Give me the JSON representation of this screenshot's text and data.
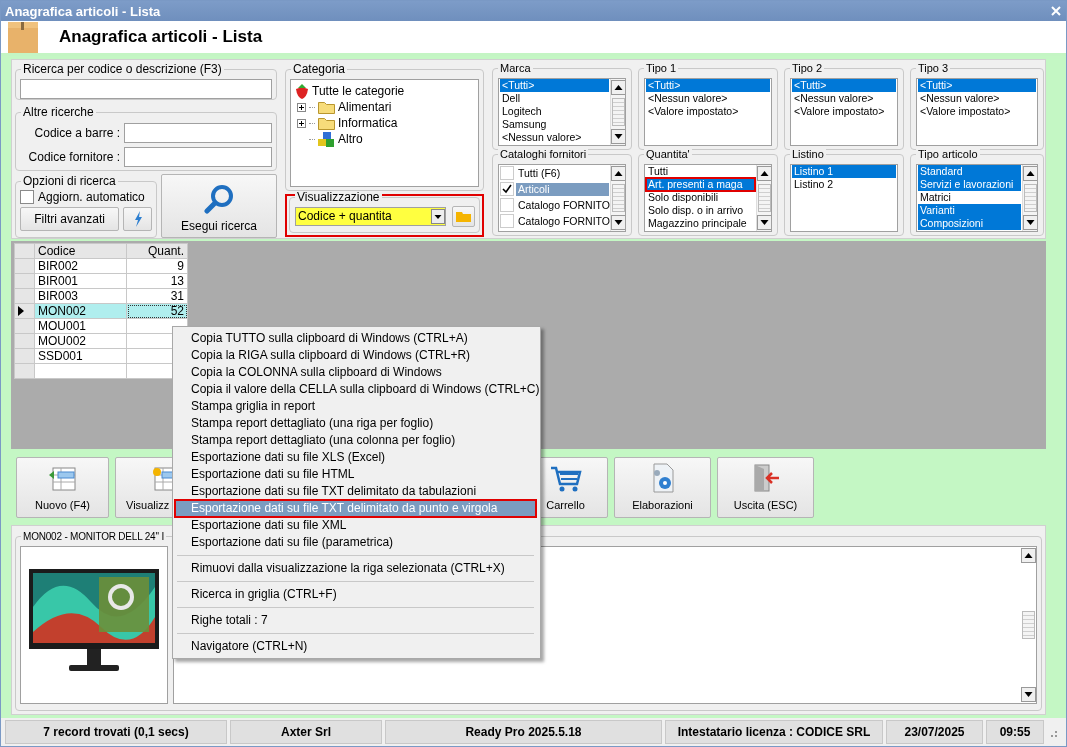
{
  "window": {
    "title": "Anagrafica articoli  - Lista"
  },
  "header": {
    "title": "Anagrafica articoli  - Lista"
  },
  "search": {
    "title": "Ricerca per codice o descrizione (F3)"
  },
  "other_searches": {
    "title": "Altre ricerche",
    "fields": [
      {
        "label": "Codice a barre :"
      },
      {
        "label": "Codice fornitore :"
      }
    ]
  },
  "search_options": {
    "title": "Opzioni di ricerca",
    "auto_update": {
      "label": "Aggiorn. automatico",
      "checked": false
    },
    "advanced_button": "Filtri avanzati"
  },
  "run_search_button": "Esegui ricerca",
  "category": {
    "title": "Categoria",
    "tree": [
      {
        "label": "Tutte le categorie",
        "kind": "root",
        "children": [
          {
            "label": "Alimentari",
            "kind": "folder",
            "expandable": true
          },
          {
            "label": "Informatica",
            "kind": "folder",
            "expandable": true
          },
          {
            "label": "Altro",
            "kind": "group",
            "expandable": false
          }
        ]
      }
    ]
  },
  "view": {
    "title": "Visualizzazione",
    "value": "Codice + quantita",
    "outlined": true
  },
  "filters": [
    {
      "title": "Marca",
      "kind": "list",
      "scrollbar": true,
      "highlight_active": true,
      "items": [
        {
          "label": "<Tutti>",
          "selected": true
        },
        {
          "label": "Dell",
          "selected": false
        },
        {
          "label": "Logitech",
          "selected": false
        },
        {
          "label": "Samsung",
          "selected": false
        },
        {
          "label": "<Nessun valore>",
          "selected": false
        }
      ]
    },
    {
      "title": "Tipo 1",
      "kind": "list",
      "scrollbar": false,
      "highlight_active": true,
      "items": [
        {
          "label": "<Tutti>",
          "selected": true
        },
        {
          "label": "<Nessun valore>",
          "selected": false
        },
        {
          "label": "<Valore impostato>",
          "selected": false
        }
      ]
    },
    {
      "title": "Tipo 2",
      "kind": "list",
      "scrollbar": false,
      "highlight_active": true,
      "items": [
        {
          "label": "<Tutti>",
          "selected": true
        },
        {
          "label": "<Nessun valore>",
          "selected": false
        },
        {
          "label": "<Valore impostato>",
          "selected": false
        }
      ]
    },
    {
      "title": "Tipo 3",
      "kind": "list",
      "scrollbar": false,
      "highlight_active": true,
      "items": [
        {
          "label": "<Tutti>",
          "selected": true
        },
        {
          "label": "<Nessun valore>",
          "selected": false
        },
        {
          "label": "<Valore impostato>",
          "selected": false
        }
      ]
    },
    {
      "title": "Cataloghi fornitori",
      "kind": "checklist",
      "scrollbar": true,
      "highlight_active": false,
      "items": [
        {
          "label": "Tutti (F6)",
          "checked": false,
          "selected": false
        },
        {
          "label": "Articoli",
          "checked": true,
          "selected": true
        },
        {
          "label": "Catalogo FORNITO",
          "checked": false,
          "selected": false
        },
        {
          "label": "Catalogo FORNITO",
          "checked": false,
          "selected": false
        }
      ]
    },
    {
      "title": "Quantita'",
      "kind": "list",
      "scrollbar": true,
      "highlight_active": true,
      "items": [
        {
          "label": "Tutti",
          "selected": false
        },
        {
          "label": "Art. presenti a maga",
          "selected": true,
          "outlined": true
        },
        {
          "label": "Solo disponibili",
          "selected": false
        },
        {
          "label": "Solo disp. o in arrivo",
          "selected": false
        },
        {
          "label": "Magazzino principale",
          "selected": false
        }
      ]
    },
    {
      "title": "Listino",
      "kind": "list",
      "scrollbar": false,
      "highlight_active": true,
      "items": [
        {
          "label": "Listino 1",
          "selected": true
        },
        {
          "label": "Listino 2",
          "selected": false
        }
      ]
    },
    {
      "title": "Tipo articolo",
      "kind": "list",
      "scrollbar": true,
      "highlight_active": true,
      "items": [
        {
          "label": "Standard",
          "selected": true
        },
        {
          "label": "Servizi e lavorazioni",
          "selected": true
        },
        {
          "label": "Matrici",
          "selected": false
        },
        {
          "label": "Varianti",
          "selected": true
        },
        {
          "label": "Composizioni",
          "selected": true
        }
      ]
    }
  ],
  "table": {
    "columns": [
      "Codice",
      "Quant."
    ],
    "rows": [
      {
        "codice": "BIR002",
        "quant": "9",
        "current": false
      },
      {
        "codice": "BIR001",
        "quant": "13",
        "current": false
      },
      {
        "codice": "BIR003",
        "quant": "31",
        "current": false
      },
      {
        "codice": "MON002",
        "quant": "52",
        "current": true
      },
      {
        "codice": "MOU001",
        "current": false
      },
      {
        "codice": "MOU002",
        "current": false
      },
      {
        "codice": "SSD001",
        "current": false
      }
    ]
  },
  "buttons": [
    {
      "label": "Nuovo (F4)"
    },
    {
      "label": "Visualizz"
    },
    {
      "label": "Carrello"
    },
    {
      "label": "Elaborazioni"
    },
    {
      "label": "Uscita (ESC)"
    }
  ],
  "detail": {
    "title": "MON002 - MONITOR DELL 24\" I"
  },
  "context_menu": [
    {
      "kind": "item",
      "label": "Copia TUTTO sulla clipboard di Windows (CTRL+A)",
      "selected": false
    },
    {
      "kind": "item",
      "label": "Copia la RIGA sulla clipboard di Windows (CTRL+R)",
      "selected": false
    },
    {
      "kind": "item",
      "label": "Copia la COLONNA sulla clipboard di Windows",
      "selected": false
    },
    {
      "kind": "item",
      "label": "Copia il valore della CELLA sulla clipboard di Windows (CTRL+C)",
      "selected": false
    },
    {
      "kind": "item",
      "label": "Stampa griglia in report",
      "selected": false
    },
    {
      "kind": "item",
      "label": "Stampa report dettagliato (una riga per foglio)",
      "selected": false
    },
    {
      "kind": "item",
      "label": "Stampa report dettagliato (una colonna per foglio)",
      "selected": false
    },
    {
      "kind": "item",
      "label": "Esportazione dati su file XLS (Excel)",
      "selected": false
    },
    {
      "kind": "item",
      "label": "Esportazione dati su file HTML",
      "selected": false
    },
    {
      "kind": "item",
      "label": "Esportazione dati su file TXT delimitato da tabulazioni",
      "selected": false
    },
    {
      "kind": "item",
      "label": "Esportazione dati su file TXT delimitato da punto e virgola",
      "selected": true,
      "outlined": true
    },
    {
      "kind": "item",
      "label": "Esportazione dati su file XML",
      "selected": false
    },
    {
      "kind": "item",
      "label": "Esportazione dati su file (parametrica)",
      "selected": false
    },
    {
      "kind": "separator"
    },
    {
      "kind": "item",
      "label": "Rimuovi dalla visualizzazione la riga selezionata (CTRL+X)",
      "selected": false
    },
    {
      "kind": "separator"
    },
    {
      "kind": "item",
      "label": "Ricerca in griglia (CTRL+F)",
      "selected": false
    },
    {
      "kind": "separator"
    },
    {
      "kind": "item",
      "label": "Righe totali : 7",
      "selected": false
    },
    {
      "kind": "separator"
    },
    {
      "kind": "item",
      "label": "Navigatore (CTRL+N)",
      "selected": false
    }
  ],
  "status_bar": [
    "7 record trovati (0,1 secs)",
    "Axter Srl",
    "Ready Pro 2025.5.18",
    "Intestatario licenza : CODICE SRL",
    "23/07/2025",
    "09:55"
  ]
}
